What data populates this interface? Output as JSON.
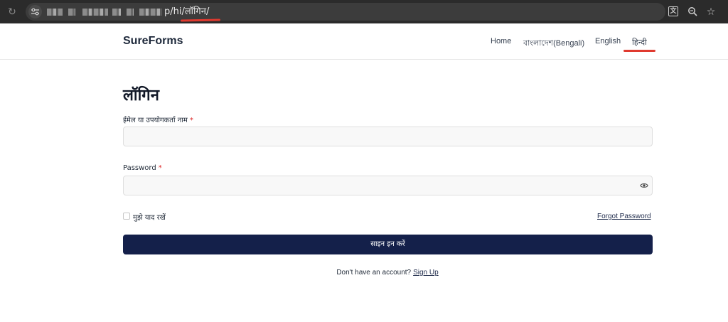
{
  "browser": {
    "url_visible": "p/hi/लॉगिन/",
    "icons": [
      "reload-icon",
      "site-settings-icon",
      "translate-icon",
      "zoom-icon",
      "bookmark-star-icon"
    ]
  },
  "header": {
    "brand": "SureForms",
    "nav": [
      {
        "label": "Home"
      },
      {
        "label": "বাংলাদেশ(Bengali)"
      },
      {
        "label": "English"
      },
      {
        "label": "हिन्दी"
      }
    ]
  },
  "form": {
    "title": "लॉगिन",
    "email_label": "ईमेल या उपयोगकर्ता नाम",
    "password_label": "Password",
    "required_mark": "*",
    "email_value": "",
    "password_value": "",
    "remember_label": "मुझे याद रखें",
    "forgot_label": "Forgot Password",
    "submit_label": "साइन इन करें",
    "signup_prompt": "Don't have an account?",
    "signup_link": "Sign Up"
  },
  "colors": {
    "accent_underline": "#e03a2f",
    "button_bg": "#14204a",
    "required": "#dc2626"
  }
}
